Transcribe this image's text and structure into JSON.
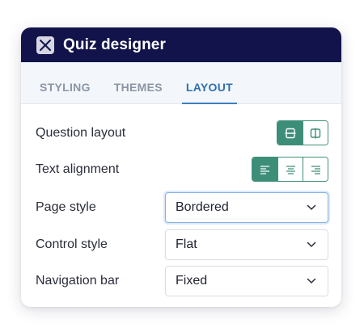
{
  "window": {
    "title": "Quiz designer",
    "icon": "close-icon"
  },
  "tabs": [
    {
      "label": "STYLING",
      "active": false
    },
    {
      "label": "THEMES",
      "active": false
    },
    {
      "label": "LAYOUT",
      "active": true
    }
  ],
  "settings": {
    "question_layout": {
      "label": "Question layout",
      "options": [
        {
          "icon": "layout-horizontal-icon",
          "selected": true
        },
        {
          "icon": "layout-vertical-icon",
          "selected": false
        }
      ]
    },
    "text_alignment": {
      "label": "Text alignment",
      "options": [
        {
          "icon": "align-left-icon",
          "selected": true
        },
        {
          "icon": "align-center-icon",
          "selected": false
        },
        {
          "icon": "align-right-icon",
          "selected": false
        }
      ]
    },
    "page_style": {
      "label": "Page style",
      "value": "Bordered"
    },
    "control_style": {
      "label": "Control style",
      "value": "Flat"
    },
    "navigation_bar": {
      "label": "Navigation bar",
      "value": "Fixed"
    }
  },
  "colors": {
    "titlebar": "#11134a",
    "accent_green": "#3d8e79",
    "active_tab": "#2f6fb2"
  }
}
